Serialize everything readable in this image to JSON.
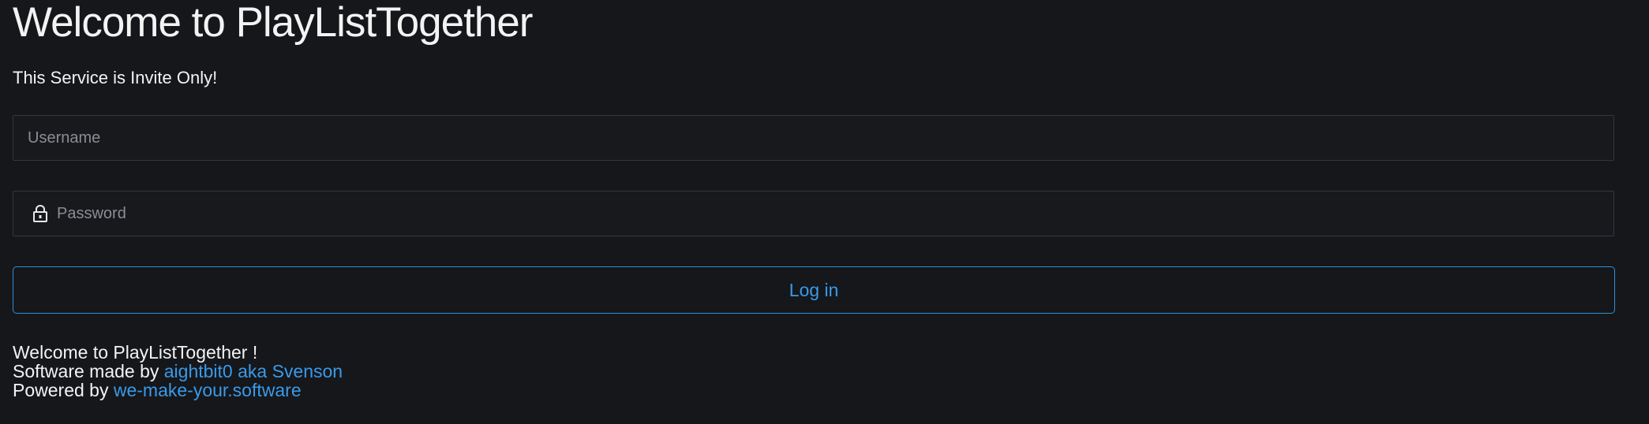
{
  "header": {
    "title": "Welcome to PlayListTogether",
    "subtitle": "This Service is Invite Only!"
  },
  "form": {
    "username_placeholder": "Username",
    "password_placeholder": "Password",
    "login_label": "Log in",
    "lock_icon": "lock-icon"
  },
  "footer": {
    "welcome_text": "Welcome to PlayListTogether !",
    "made_by_prefix": "Software made by",
    "made_by_link": "aightbit0 aka Svenson",
    "powered_by_prefix": "Powered by",
    "powered_by_link": "we-make-your.software"
  },
  "colors": {
    "background": "#15171b",
    "accent": "#3a9ae8",
    "field_border": "#33363c"
  }
}
